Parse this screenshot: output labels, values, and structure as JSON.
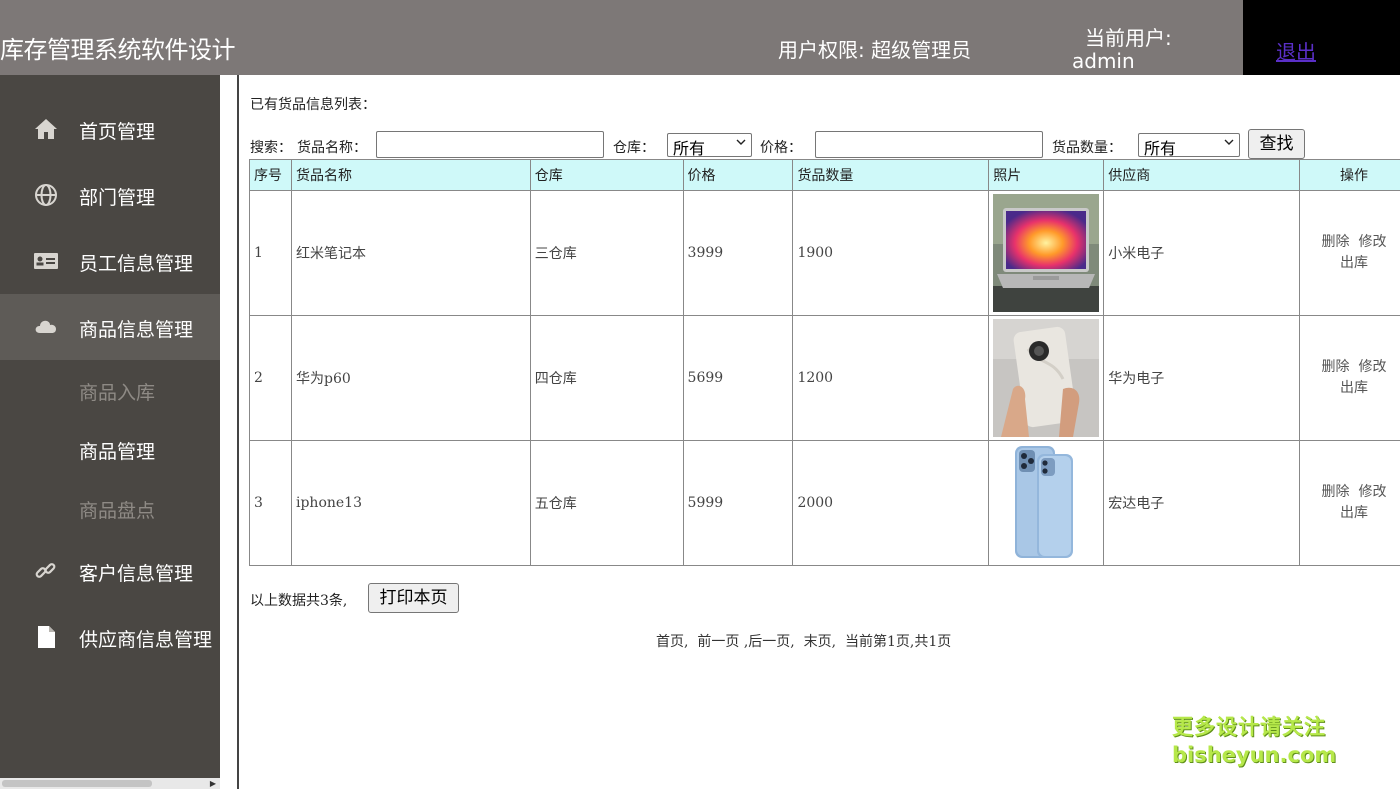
{
  "header": {
    "app_title": "库存管理系统软件设计",
    "role_text": "用户权限: 超级管理员",
    "user_label": "当前用户:",
    "user_name": "admin",
    "logout_label": "退出"
  },
  "sidebar": {
    "items": [
      {
        "label": "首页管理",
        "icon": "home-icon"
      },
      {
        "label": "部门管理",
        "icon": "globe-icon"
      },
      {
        "label": "员工信息管理",
        "icon": "id-card-icon"
      },
      {
        "label": "商品信息管理",
        "icon": "cloud-icon",
        "active": true
      },
      {
        "label": "客户信息管理",
        "icon": "link-icon"
      },
      {
        "label": "供应商信息管理",
        "icon": "file-icon"
      }
    ],
    "sub_items": [
      {
        "label": "商品入库"
      },
      {
        "label": "商品管理"
      },
      {
        "label": "商品盘点"
      }
    ]
  },
  "content": {
    "list_title": "已有货品信息列表：",
    "search": {
      "prefix": "搜索：",
      "name_label": "货品名称：",
      "name_value": "",
      "warehouse_label": "仓库：",
      "warehouse_selected": "所有",
      "price_label": "价格：",
      "price_value": "",
      "quantity_label": "货品数量：",
      "quantity_selected": "所有",
      "find_button": "查找"
    },
    "table": {
      "headers": [
        "序号",
        "货品名称",
        "仓库",
        "价格",
        "货品数量",
        "照片",
        "供应商",
        "操作"
      ],
      "rows": [
        {
          "id": "1",
          "name": "红米笔记本",
          "warehouse": "三仓库",
          "price": "3999",
          "quantity": "1900",
          "photo": "laptop-photo",
          "supplier": "小米电子",
          "op_delete": "删除",
          "op_edit": "修改",
          "op_out": "出库"
        },
        {
          "id": "2",
          "name": "华为p60",
          "warehouse": "四仓库",
          "price": "5699",
          "quantity": "1200",
          "photo": "phone-photo",
          "supplier": "华为电子",
          "op_delete": "删除",
          "op_edit": "修改",
          "op_out": "出库"
        },
        {
          "id": "3",
          "name": "iphone13",
          "warehouse": "五仓库",
          "price": "5999",
          "quantity": "2000",
          "photo": "iphone-photo",
          "supplier": "宏达电子",
          "op_delete": "删除",
          "op_edit": "修改",
          "op_out": "出库"
        }
      ]
    },
    "total_text": "以上数据共3条,",
    "print_button": "打印本页",
    "pager": {
      "first": "首页,",
      "prev": "前一页",
      "next": ",后一页,",
      "last": "末页,",
      "status": "当前第1页,共1页"
    }
  },
  "watermark": {
    "line1": "更多设计请关注",
    "line2": "bisheyun.com"
  },
  "colors": {
    "header_bg": "#7d7877",
    "sidebar_bg": "#4a4743",
    "sidebar_active_bg": "#5e5b57",
    "table_header_bg": "#cff9f9",
    "logout_link": "#5a2fc7"
  }
}
